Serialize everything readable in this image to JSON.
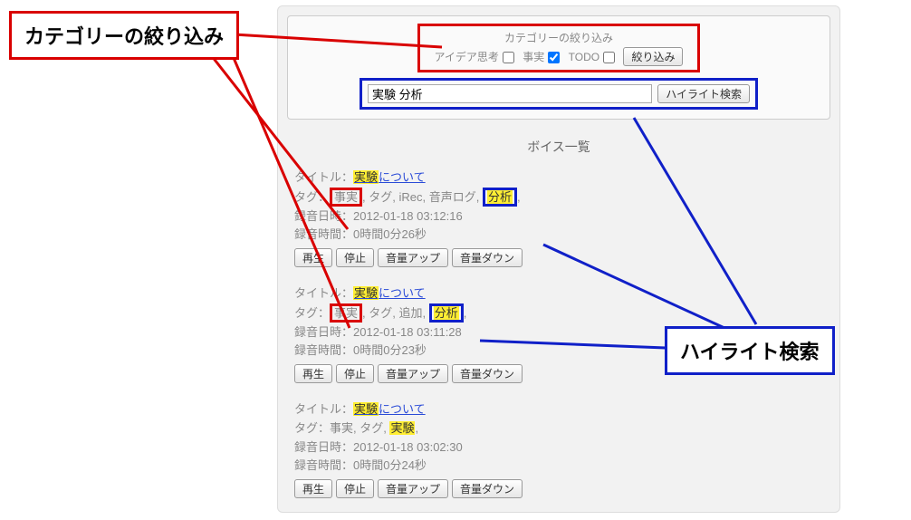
{
  "callout_red": "カテゴリーの絞り込み",
  "callout_blue": "ハイライト検索",
  "filter": {
    "title": "カテゴリーの絞り込み",
    "cats": [
      "アイデア思考",
      "事実",
      "TODO"
    ],
    "checked": [
      false,
      true,
      false
    ],
    "filter_btn": "絞り込み"
  },
  "search": {
    "value": "実験 分析",
    "btn": "ハイライト検索"
  },
  "list_header": "ボイス一覧",
  "labels": {
    "title": "タイトル：",
    "tag": "タグ：",
    "recdate": "録音日時：",
    "rectime": "録音時間："
  },
  "buttons": {
    "play": "再生",
    "stop": "停止",
    "volup": "音量アップ",
    "voldown": "音量ダウン"
  },
  "items": [
    {
      "title_hl": "実験",
      "title_rest": "について",
      "tag_tokens": [
        {
          "text": "事実",
          "box": "red"
        },
        {
          "text": ", タグ, iRec, 音声ログ, "
        },
        {
          "text": "分析",
          "box": "blue",
          "hl": true
        },
        {
          "text": ","
        }
      ],
      "recdate": "2012-01-18 03:12:16",
      "rectime": "0時間0分26秒"
    },
    {
      "title_hl": "実験",
      "title_rest": "について",
      "tag_tokens": [
        {
          "text": "事実",
          "box": "red"
        },
        {
          "text": ", タグ, 追加, "
        },
        {
          "text": "分析",
          "box": "blue",
          "hl": true
        },
        {
          "text": ","
        }
      ],
      "recdate": "2012-01-18 03:11:28",
      "rectime": "0時間0分23秒"
    },
    {
      "title_hl": "実験",
      "title_rest": "について",
      "tag_tokens": [
        {
          "text": "事実, タグ, "
        },
        {
          "text": "実験",
          "hl": true
        },
        {
          "text": ","
        }
      ],
      "recdate": "2012-01-18 03:02:30",
      "rectime": "0時間0分24秒"
    }
  ]
}
